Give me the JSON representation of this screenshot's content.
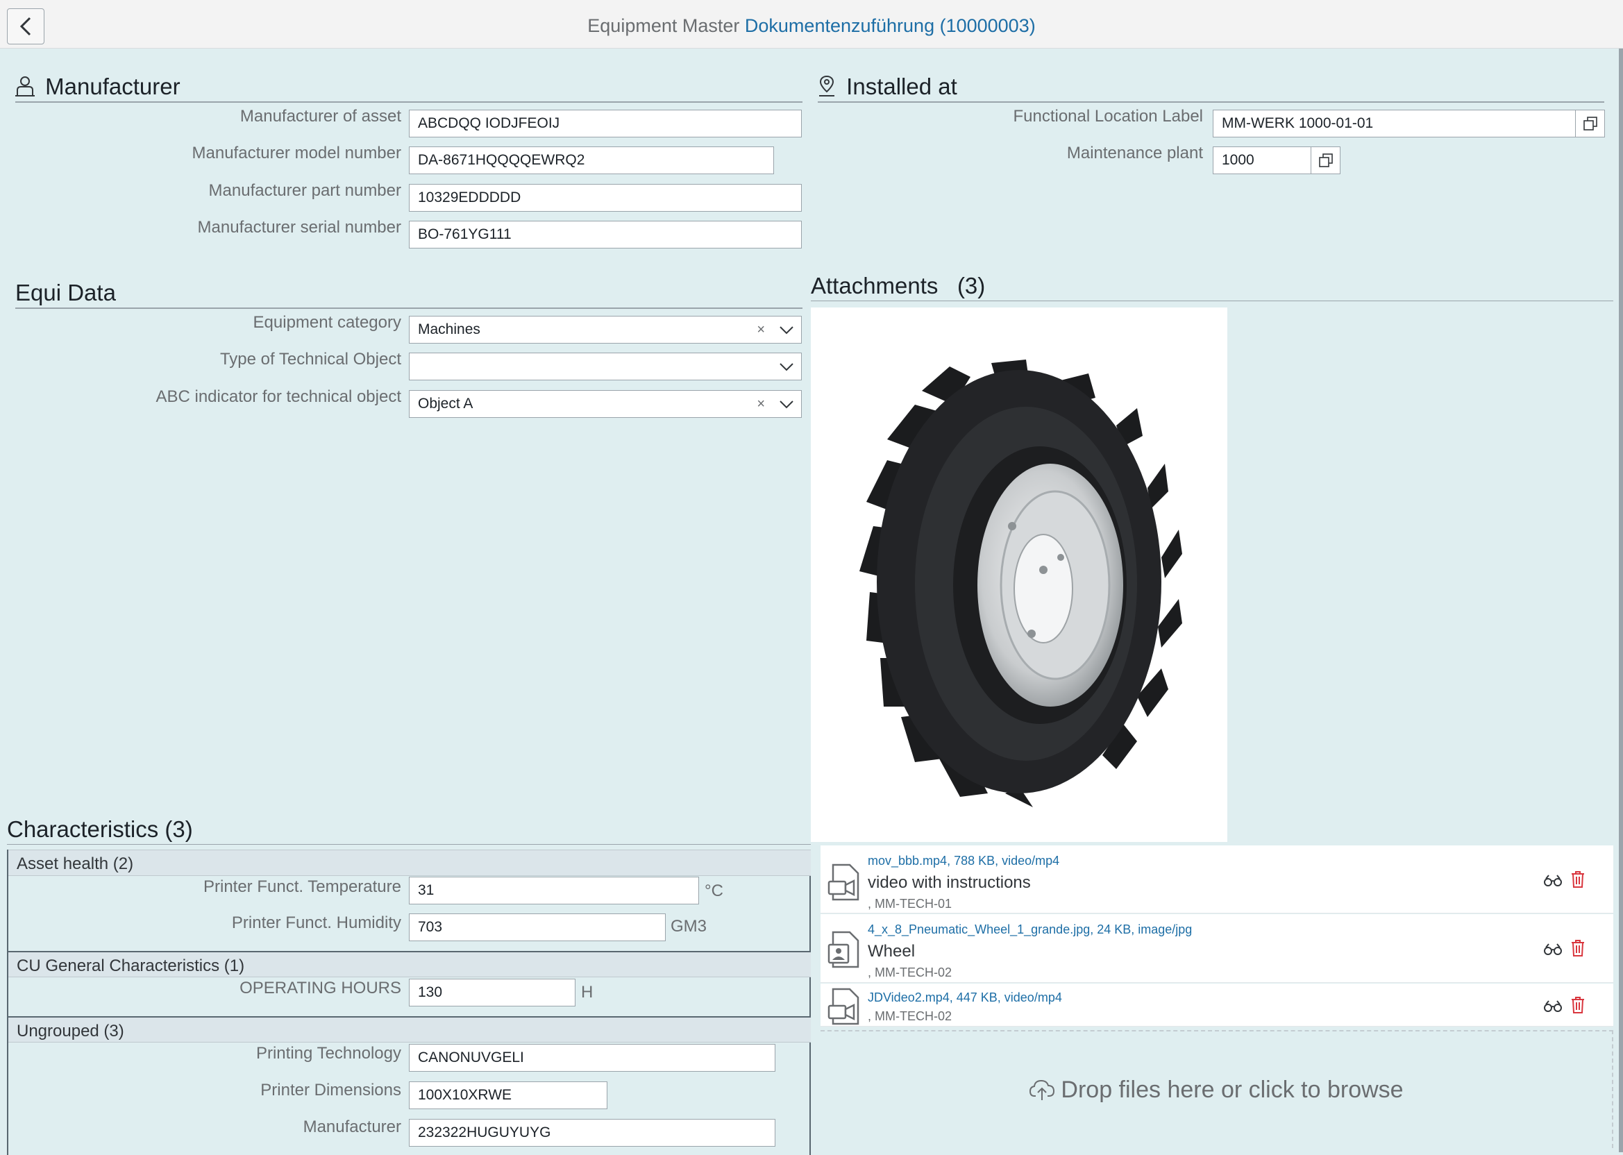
{
  "header": {
    "title_prefix": "Equipment Master",
    "title_link": "Dokumentenzuführung (10000003)"
  },
  "manufacturer": {
    "title": "Manufacturer",
    "fields": [
      {
        "label": "Manufacturer of asset",
        "value": "ABCDQQ IODJFEOIJ"
      },
      {
        "label": "Manufacturer model number",
        "value": "DA-8671HQQQQEWRQ2"
      },
      {
        "label": "Manufacturer part number",
        "value": "10329EDDDDD"
      },
      {
        "label": "Manufacturer serial number",
        "value": "BO-761YG111"
      }
    ]
  },
  "installed_at": {
    "title": "Installed at",
    "fields": [
      {
        "label": "Functional Location Label",
        "value": "MM-WERK 1000-01-01"
      },
      {
        "label": "Maintenance plant",
        "value": "1000"
      }
    ]
  },
  "equi_data": {
    "title": "Equi Data",
    "fields": [
      {
        "label": "Equipment category",
        "value": "Machines",
        "clear": "×"
      },
      {
        "label": "Type of Technical Object",
        "value": ""
      },
      {
        "label": "ABC indicator for technical object",
        "value": "Object A",
        "clear": "×"
      }
    ]
  },
  "characteristics": {
    "title": "Characteristics (3)",
    "groups": [
      {
        "header": "Asset health (2)",
        "rows": [
          {
            "label": "Printer Funct. Temperature",
            "value": "31",
            "unit": "°C"
          },
          {
            "label": "Printer Funct. Humidity",
            "value": "703",
            "unit": "GM3"
          }
        ]
      },
      {
        "header": "CU General Characteristics (1)",
        "rows": [
          {
            "label": "OPERATING HOURS",
            "value": "130",
            "unit": "H"
          }
        ]
      },
      {
        "header": "Ungrouped (3)",
        "rows": [
          {
            "label": "Printing Technology",
            "value": "CANONUVGELI"
          },
          {
            "label": "Printer Dimensions",
            "value": "100X10XRWE"
          },
          {
            "label": "Manufacturer",
            "value": "232322HUGUYUYG"
          }
        ]
      }
    ]
  },
  "attachments": {
    "title": "Attachments",
    "count": "(3)",
    "items": [
      {
        "file": "mov_bbb.mp4, 788 KB, video/mp4",
        "description": "video with instructions",
        "sub": ", MM-TECH-01",
        "icon": "video-file-icon"
      },
      {
        "file": "4_x_8_Pneumatic_Wheel_1_grande.jpg, 24 KB, image/jpg",
        "description": "Wheel",
        "sub": ", MM-TECH-02",
        "icon": "image-file-icon"
      },
      {
        "file": "JDVideo2.mp4, 447 KB, video/mp4",
        "description": "",
        "sub": ", MM-TECH-02",
        "icon": "video-file-icon"
      }
    ],
    "dropzone": "Drop files here or click to browse"
  },
  "colors": {
    "background": "#dfeef0",
    "link": "#1d6ea6",
    "delete": "#d9363e"
  }
}
